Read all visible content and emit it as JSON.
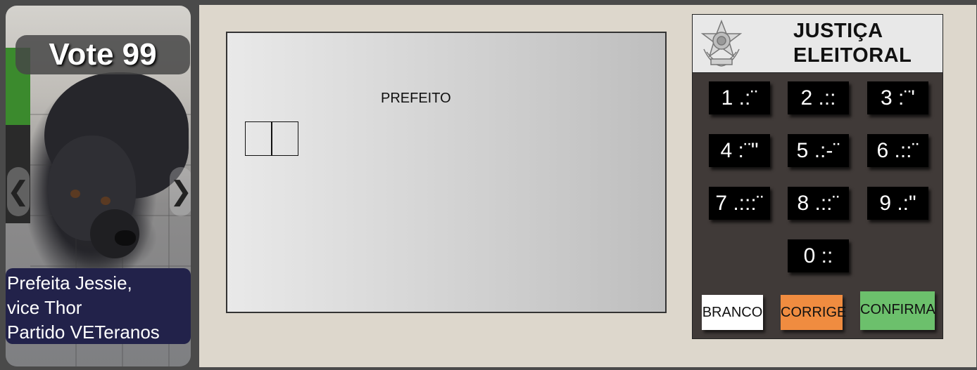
{
  "candidate_card": {
    "vote_text": "Vote 99",
    "prev_arrow": "❮",
    "next_arrow": "❯",
    "caption_lines": [
      "Prefeita Jessie,",
      "vice Thor",
      "Partido VETeranos"
    ]
  },
  "screen": {
    "role_label": "PREFEITO",
    "digit_slots": [
      "",
      ""
    ]
  },
  "panel": {
    "title_line1": "JUSTIÇA",
    "title_line2": "ELEITORAL",
    "emblem_icon": "brazil-coat-of-arms-icon",
    "keys": [
      {
        "digit": "1",
        "braille": ".:¨"
      },
      {
        "digit": "2",
        "braille": ".::"
      },
      {
        "digit": "3",
        "braille": ":¨'"
      },
      {
        "digit": "4",
        "braille": ":¨\""
      },
      {
        "digit": "5",
        "braille": ".:-¨"
      },
      {
        "digit": "6",
        "braille": ".::¨"
      },
      {
        "digit": "7",
        "braille": ".:::¨"
      },
      {
        "digit": "8",
        "braille": ".::¨"
      },
      {
        "digit": "9",
        "braille": ".:\""
      },
      {
        "digit": "0",
        "braille": "::"
      }
    ],
    "branco_label": "BRANCO",
    "corrige_label": "CORRIGE",
    "confirma_label": "CONFIRMA"
  },
  "colors": {
    "branco": "#ffffff",
    "corrige": "#f08c40",
    "confirma": "#6cc06c",
    "panel_bg": "#403a38",
    "caption_bg": "#22224a"
  }
}
